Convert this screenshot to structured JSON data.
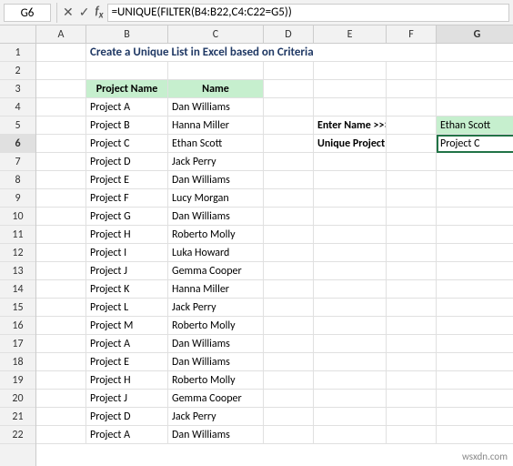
{
  "formula_bar": {
    "cell_ref": "G6",
    "formula": "=UNIQUE(FILTER(B4:B22,C4:C22=G5))"
  },
  "title": "Create a Unique List in Excel based on Criteria",
  "columns": [
    "A",
    "B",
    "C",
    "D",
    "E",
    "F",
    "G"
  ],
  "rows": [
    {
      "num": 1,
      "cells": {
        "b": "Create a Unique List in Excel based on Criteria",
        "is_title": true
      }
    },
    {
      "num": 2,
      "cells": {}
    },
    {
      "num": 3,
      "cells": {
        "b": "Project Name",
        "c": "Name",
        "is_header": true
      }
    },
    {
      "num": 4,
      "cells": {
        "b": "Project A",
        "c": "Dan Williams"
      }
    },
    {
      "num": 5,
      "cells": {
        "b": "Project B",
        "c": "Hanna Miller",
        "e": "Enter Name >>>",
        "g": "Ethan Scott",
        "g_class": "input-cell"
      }
    },
    {
      "num": 6,
      "cells": {
        "b": "Project C",
        "c": "Ethan Scott",
        "e": "Unique Project List",
        "g": "Project C",
        "g_class": "active-cell",
        "row_active": true
      }
    },
    {
      "num": 7,
      "cells": {
        "b": "Project D",
        "c": "Jack Perry"
      }
    },
    {
      "num": 8,
      "cells": {
        "b": "Project E",
        "c": "Dan Williams"
      }
    },
    {
      "num": 9,
      "cells": {
        "b": "Project F",
        "c": "Lucy Morgan"
      }
    },
    {
      "num": 10,
      "cells": {
        "b": "Project G",
        "c": "Dan Williams"
      }
    },
    {
      "num": 11,
      "cells": {
        "b": "Project H",
        "c": "Roberto Molly"
      }
    },
    {
      "num": 12,
      "cells": {
        "b": "Project I",
        "c": "Luka Howard"
      }
    },
    {
      "num": 13,
      "cells": {
        "b": "Project J",
        "c": "Gemma Cooper"
      }
    },
    {
      "num": 14,
      "cells": {
        "b": "Project K",
        "c": "Hanna Miller"
      }
    },
    {
      "num": 15,
      "cells": {
        "b": "Project L",
        "c": "Jack Perry"
      }
    },
    {
      "num": 16,
      "cells": {
        "b": "Project M",
        "c": "Roberto Molly"
      }
    },
    {
      "num": 17,
      "cells": {
        "b": "Project A",
        "c": "Dan Williams"
      }
    },
    {
      "num": 18,
      "cells": {
        "b": "Project E",
        "c": "Dan Williams"
      }
    },
    {
      "num": 19,
      "cells": {
        "b": "Project H",
        "c": "Roberto Molly"
      }
    },
    {
      "num": 20,
      "cells": {
        "b": "Project J",
        "c": "Gemma Cooper"
      }
    },
    {
      "num": 21,
      "cells": {
        "b": "Project D",
        "c": "Jack Perry"
      }
    },
    {
      "num": 22,
      "cells": {
        "b": "Project A",
        "c": "Dan Williams"
      }
    }
  ],
  "watermark": "wsxdn.com"
}
